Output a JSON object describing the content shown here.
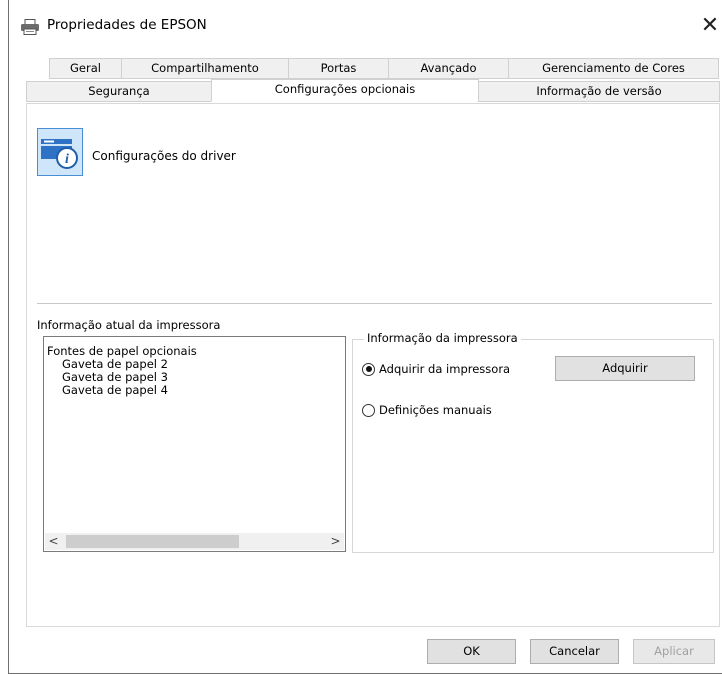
{
  "window": {
    "title": "Propriedades de EPSON",
    "close_glyph": "✕"
  },
  "tabs": {
    "row1": [
      "Geral",
      "Compartilhamento",
      "Portas",
      "Avançado",
      "Gerenciamento de Cores"
    ],
    "row2": [
      "Segurança",
      "Configurações opcionais",
      "Informação de versão"
    ],
    "active": "Configurações opcionais"
  },
  "driver": {
    "label": "Configurações do driver",
    "icon": "printer-info-icon"
  },
  "printer_info_section": {
    "label": "Informação atual da impressora",
    "list_items": [
      "Fontes de papel opcionais",
      "Gaveta de papel 2",
      "Gaveta de papel 3",
      "Gaveta de papel 4"
    ],
    "scroll_left": "<",
    "scroll_right": ">"
  },
  "printer_group": {
    "legend": "Informação da impressora",
    "radio_acquire": "Adquirir da impressora",
    "radio_manual": "Definições manuais",
    "selected": "Adquirir da impressora",
    "acquire_button": "Adquirir"
  },
  "footer": {
    "ok": "OK",
    "cancel": "Cancelar",
    "apply": "Aplicar"
  },
  "colors": {
    "accent": "#4a8fd6",
    "icon_bg": "#cfe5f9"
  }
}
